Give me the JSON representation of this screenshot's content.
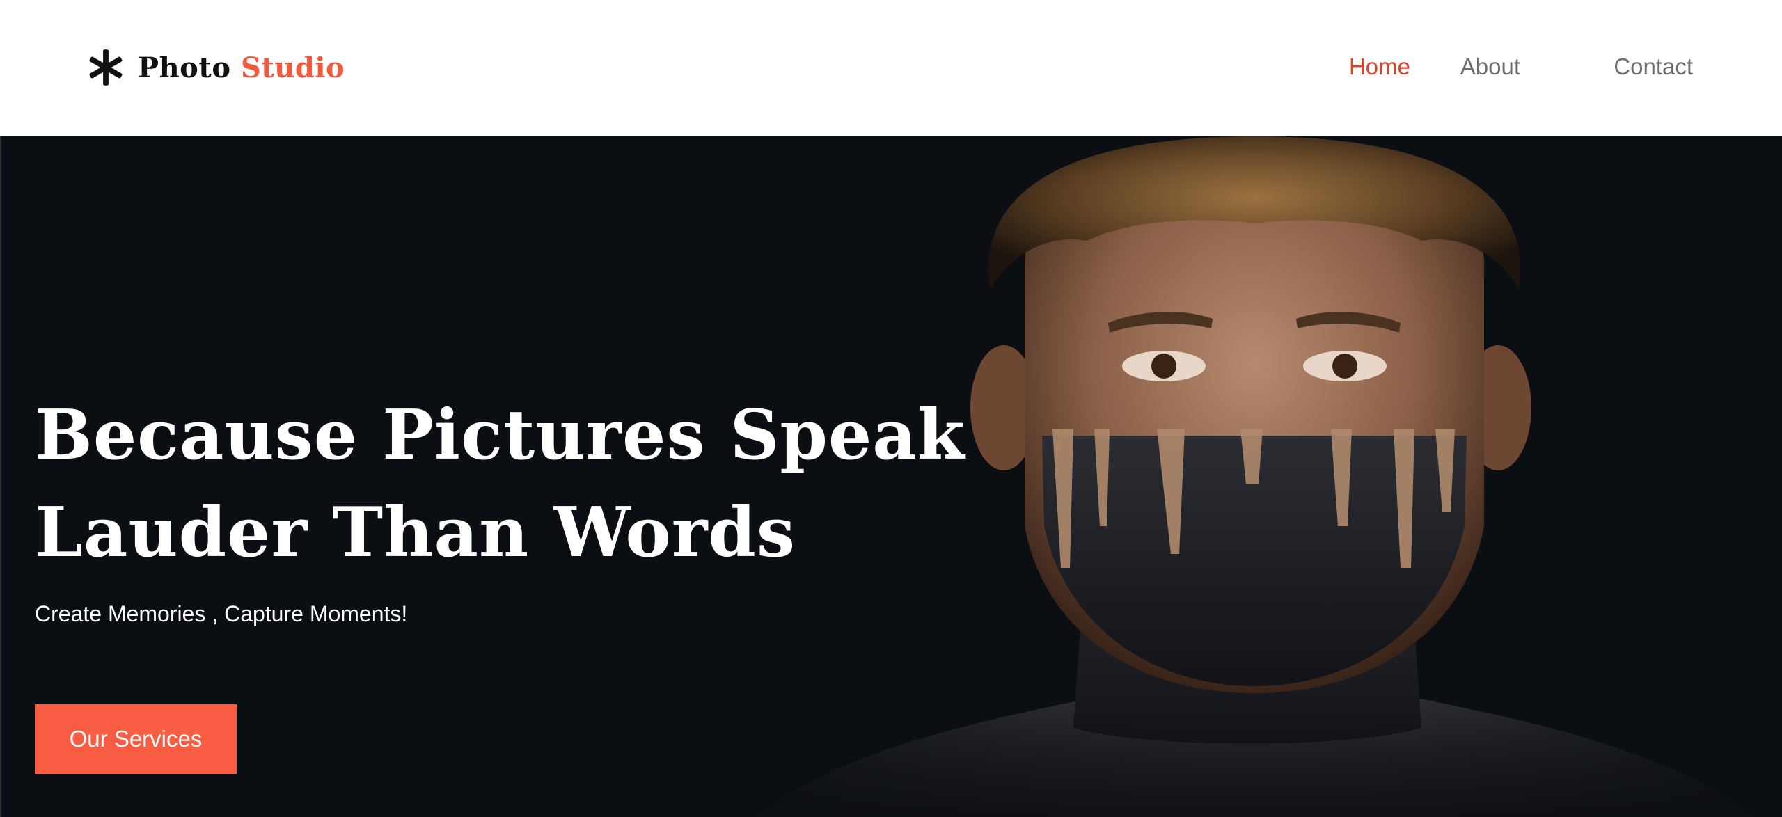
{
  "brand": {
    "name_part1": "Photo",
    "name_part2": "Studio",
    "icon": "asterisk-logo-icon",
    "accent_color": "#f15a3f"
  },
  "nav": {
    "items": [
      {
        "label": "Home",
        "active": true
      },
      {
        "label": "About",
        "active": false
      },
      {
        "label": "Contact",
        "active": false
      }
    ],
    "active_color": "#e0412a",
    "inactive_color": "#6b6e73"
  },
  "hero": {
    "title_line1": "Because Pictures Speak",
    "title_line2": "Lauder Than Words",
    "subtitle": "Create Memories , Capture Moments!",
    "cta_label": "Our Services",
    "cta_color": "#f85c43",
    "background_color": "#0b0e12",
    "image": "portrait-photo"
  }
}
